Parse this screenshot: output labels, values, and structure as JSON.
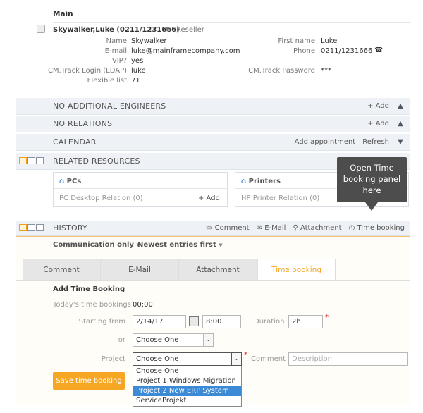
{
  "main_heading": "Main",
  "contact": {
    "name_line": "Skywalker,Luke (0211/1231666)",
    "role": "Reseller",
    "fields_left": [
      {
        "label": "Name",
        "value": "Skywalker"
      },
      {
        "label": "E-mail",
        "value": "luke@mainframecompany.com"
      },
      {
        "label": "VIP?",
        "value": "yes"
      },
      {
        "label": "CM.Track Login (LDAP)",
        "value": "luke"
      },
      {
        "label": "Flexible list",
        "value": "71"
      }
    ],
    "fields_right": [
      {
        "label": "First name",
        "value": "Luke"
      },
      {
        "label": "Phone",
        "value": "0211/1231666"
      },
      {
        "label": "CM.Track Password",
        "value": "***"
      }
    ]
  },
  "sections": {
    "engineers": {
      "title": "NO ADDITIONAL ENGINEERS",
      "add": "+ Add"
    },
    "relations": {
      "title": "NO RELATIONS",
      "add": "+ Add"
    },
    "calendar": {
      "title": "CALENDAR",
      "add_appointment": "Add appointment",
      "refresh": "Refresh"
    },
    "resources": {
      "title": "RELATED RESOURCES"
    },
    "history": {
      "title": "HISTORY",
      "comment": "Comment",
      "email": "E-Mail",
      "attachment": "Attachment",
      "time_booking": "Time booking"
    }
  },
  "resources": {
    "pcs": {
      "title": "PCs",
      "item": "PC Desktop Relation (0)",
      "add": "+ Add"
    },
    "printers": {
      "title": "Printers",
      "item": "HP Printer Relation (0)"
    }
  },
  "tooltip": "Open Time booking panel here",
  "filters": {
    "communication": "Communication only",
    "order": "Newest entries first"
  },
  "tabs": [
    "Comment",
    "E-Mail",
    "Attachment",
    "Time booking"
  ],
  "form": {
    "title": "Add Time Booking",
    "todays_label": "Today's time bookings",
    "todays_value": "00:00",
    "starting_label": "Starting from",
    "date_value": "2/14/17",
    "time_value": "8:00",
    "duration_label": "Duration",
    "duration_value": "2h",
    "required_mark": "*",
    "or_label": "or",
    "or_select": "Choose One",
    "project_label": "Project",
    "project_select": "Choose One",
    "comment_label": "Comment",
    "comment_placeholder": "Description",
    "save_label": "Save time booking",
    "options": [
      "Choose One",
      "Project 1 Windows Migration",
      "Project 2 New ERP System",
      "ServiceProjekt"
    ]
  },
  "colors": {
    "accent": "#f5a623",
    "section_bg": "#eef1f6",
    "selected": "#3c8ad6"
  }
}
